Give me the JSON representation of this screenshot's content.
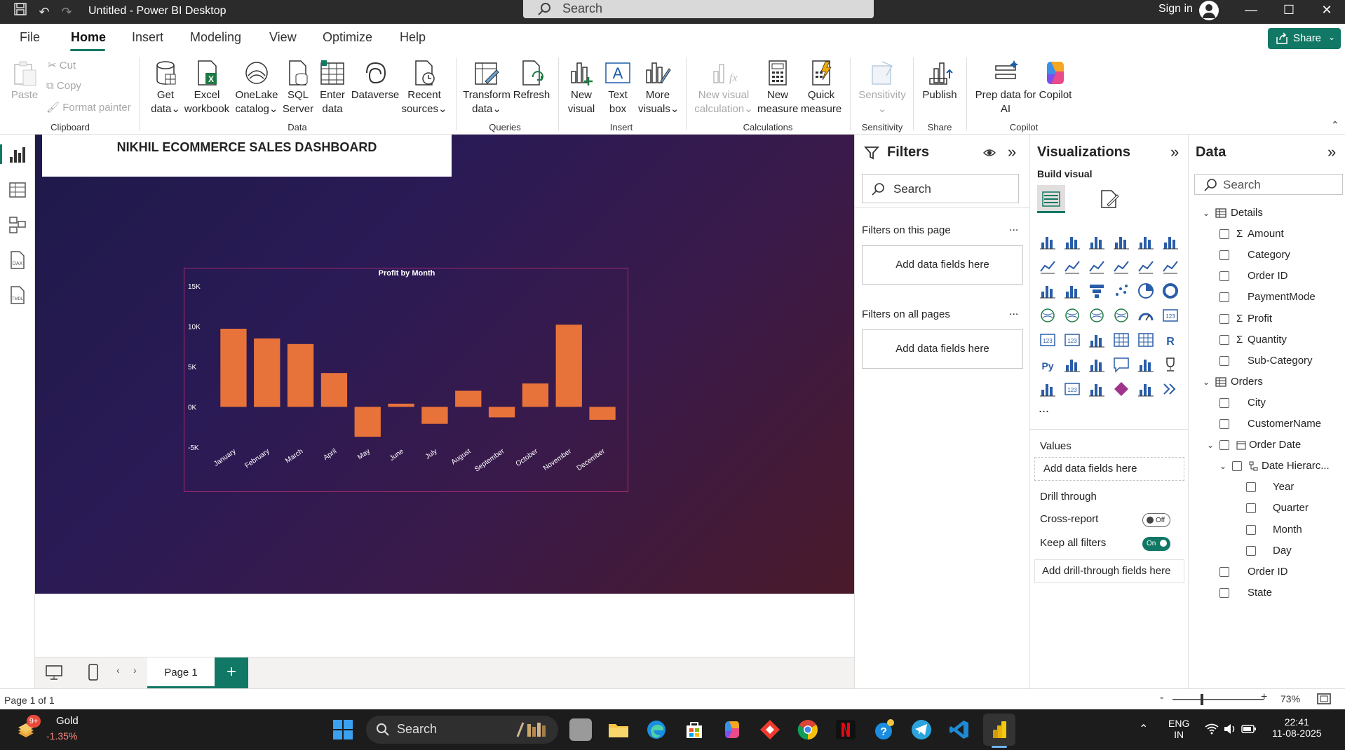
{
  "window": {
    "title": "Untitled - Power BI Desktop",
    "search_placeholder": "Search",
    "signin_label": "Sign in"
  },
  "menu": {
    "tabs": [
      "File",
      "Home",
      "Insert",
      "Modeling",
      "View",
      "Optimize",
      "Help"
    ],
    "active_tab": "Home",
    "share_label": "Share"
  },
  "ribbon": {
    "clipboard": {
      "paste": "Paste",
      "cut": "Cut",
      "copy": "Copy",
      "format_painter": "Format painter",
      "group": "Clipboard"
    },
    "data": {
      "get_data": [
        "Get",
        "data"
      ],
      "excel": [
        "Excel",
        "workbook"
      ],
      "onelake": [
        "OneLake",
        "catalog"
      ],
      "sql": [
        "SQL",
        "Server"
      ],
      "enter": [
        "Enter",
        "data"
      ],
      "dataverse": "Dataverse",
      "recent": [
        "Recent",
        "sources"
      ],
      "group": "Data"
    },
    "queries": {
      "transform": [
        "Transform",
        "data"
      ],
      "refresh": "Refresh",
      "group": "Queries"
    },
    "insert": {
      "new_visual": [
        "New",
        "visual"
      ],
      "text_box": [
        "Text",
        "box"
      ],
      "more_visuals": [
        "More",
        "visuals"
      ],
      "group": "Insert"
    },
    "calculations": {
      "new_visual_calc": [
        "New visual",
        "calculation"
      ],
      "new_measure": [
        "New",
        "measure"
      ],
      "quick_measure": [
        "Quick",
        "measure"
      ],
      "group": "Calculations"
    },
    "sensitivity": {
      "label": "Sensitivity",
      "group": "Sensitivity"
    },
    "share": {
      "publish": "Publish",
      "group": "Share"
    },
    "copilot": {
      "prep": [
        "Prep data for",
        "AI"
      ],
      "copilot": "Copilot",
      "group": "Copilot"
    }
  },
  "canvas": {
    "dashboard_title": "NIKHIL ECOMMERCE SALES DASHBOARD"
  },
  "chart_data": {
    "type": "bar",
    "title": "Profit by Month",
    "categories": [
      "January",
      "February",
      "March",
      "April",
      "May",
      "June",
      "July",
      "August",
      "September",
      "October",
      "November",
      "December"
    ],
    "values": [
      9700,
      8500,
      7800,
      4200,
      -3700,
      400,
      -2100,
      2000,
      -1300,
      2900,
      10200,
      -1600
    ],
    "yticks": [
      15000,
      10000,
      5000,
      0,
      -5000
    ],
    "ytick_labels": [
      "15K",
      "10K",
      "5K",
      "0K",
      "-5K"
    ],
    "ylim": [
      -5000,
      15000
    ],
    "bar_color": "#e8733a"
  },
  "pages": {
    "tabs": [
      "Page 1"
    ],
    "add_label": "+",
    "status": "Page 1 of 1",
    "zoom": "73%"
  },
  "filters": {
    "title": "Filters",
    "search_placeholder": "Search",
    "on_this_page": "Filters on this page",
    "on_all_pages": "Filters on all pages",
    "add_fields": "Add data fields here",
    "more": "..."
  },
  "visualizations": {
    "title": "Visualizations",
    "build_visual": "Build visual",
    "values_label": "Values",
    "values_placeholder": "Add data fields here",
    "drill_through": "Drill through",
    "cross_report": "Cross-report",
    "cross_report_state": "Off",
    "keep_all_filters": "Keep all filters",
    "keep_all_filters_state": "On",
    "drill_placeholder": "Add drill-through fields here",
    "more": "..."
  },
  "data_pane": {
    "title": "Data",
    "search_placeholder": "Search",
    "tables": [
      {
        "name": "Details",
        "fields": [
          {
            "name": "Amount",
            "sigma": true
          },
          {
            "name": "Category",
            "sigma": false
          },
          {
            "name": "Order ID",
            "sigma": false
          },
          {
            "name": "PaymentMode",
            "sigma": false
          },
          {
            "name": "Profit",
            "sigma": true
          },
          {
            "name": "Quantity",
            "sigma": true
          },
          {
            "name": "Sub-Category",
            "sigma": false
          }
        ]
      },
      {
        "name": "Orders",
        "fields": [
          {
            "name": "City"
          },
          {
            "name": "CustomerName"
          },
          {
            "name": "Order Date"
          },
          {
            "name": "Date Hierarc..."
          },
          {
            "name": "Year"
          },
          {
            "name": "Quarter"
          },
          {
            "name": "Month"
          },
          {
            "name": "Day"
          },
          {
            "name": "Order ID"
          },
          {
            "name": "State"
          }
        ]
      }
    ]
  },
  "taskbar": {
    "widget_name": "Gold",
    "widget_change": "-1.35%",
    "badge": "9+",
    "search_label": "Search",
    "lang": [
      "ENG",
      "IN"
    ],
    "time": "22:41",
    "date": "11-08-2025"
  },
  "colors": {
    "accent": "#117865",
    "bar": "#e8733a",
    "chart_border": "#a02a70"
  }
}
